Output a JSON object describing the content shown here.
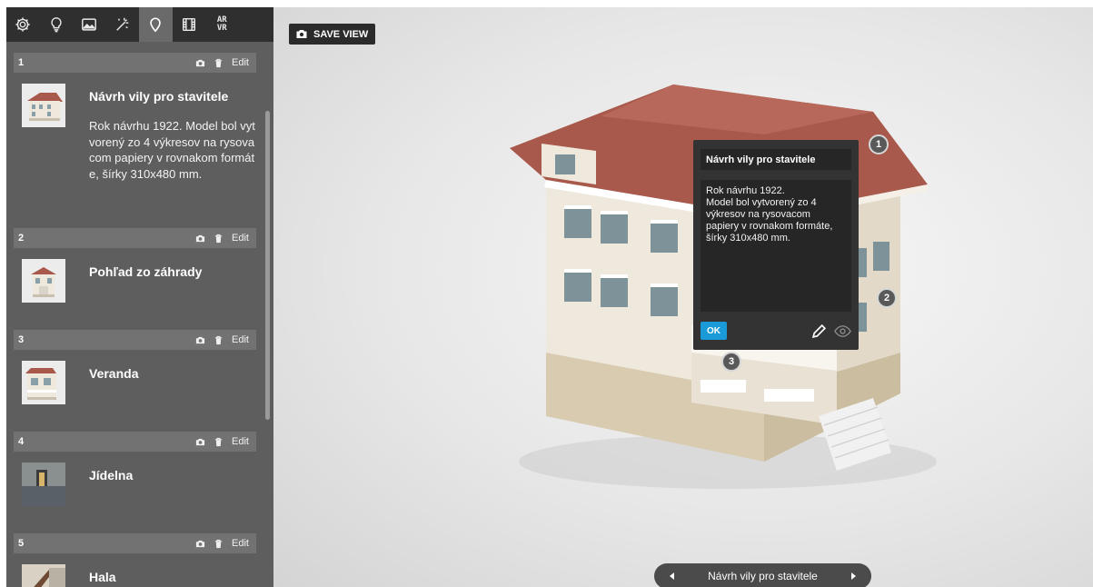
{
  "toolbar": {
    "tools": [
      "settings-icon",
      "lightbulb-icon",
      "image-icon",
      "magic-wand-icon",
      "map-pin-icon",
      "film-icon",
      "ar-vr-icon"
    ],
    "active": "map-pin-icon",
    "arvr_label_top": "AR",
    "arvr_label_bottom": "VR"
  },
  "annotations": {
    "edit_label": "Edit",
    "items": [
      {
        "number": "1",
        "title": "Návrh vily pro stavitele",
        "description": "Rok návrhu 1922. Model bol vytvorený zo 4 výkresov na rysovacom papiery v rovnakom formáte, šírky 310x480 mm."
      },
      {
        "number": "2",
        "title": "Pohľad zo záhrady",
        "description": ""
      },
      {
        "number": "3",
        "title": "Veranda",
        "description": ""
      },
      {
        "number": "4",
        "title": "Jídelna",
        "description": ""
      },
      {
        "number": "5",
        "title": "Hala",
        "description": ""
      }
    ]
  },
  "viewer": {
    "save_view_label": "SAVE VIEW",
    "markers": [
      "1",
      "2",
      "3"
    ],
    "popup": {
      "title": "Návrh vily pro stavitele",
      "text": "Rok návrhu 1922.\nModel bol vytvorený zo 4 výkresov na rysovacom papiery v rovnakom formáte, šírky 310x480 mm.",
      "ok_label": "OK"
    },
    "nav": {
      "current": "Návrh vily pro stavitele"
    }
  },
  "colors": {
    "accent": "#1a9ad6",
    "panel": "#5e5e5e",
    "toolbar": "#2f2f2f",
    "roof": "#a8594b",
    "facade": "#efe8dc"
  }
}
